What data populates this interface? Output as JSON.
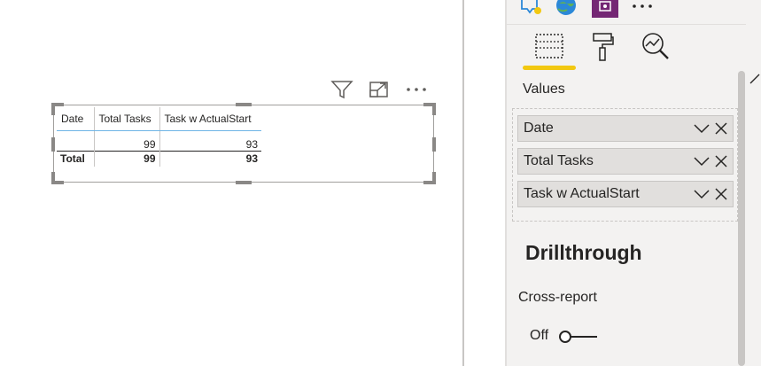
{
  "visual_header": {
    "filter_icon": "filter-icon",
    "focus_icon": "focus-mode-icon",
    "more_icon": "more-options-icon"
  },
  "table": {
    "columns": [
      "Date",
      "Total Tasks",
      "Task w ActualStart"
    ],
    "row": {
      "date": "",
      "total_tasks": "99",
      "task_w_actualstart": "93"
    },
    "total": {
      "label": "Total",
      "total_tasks": "99",
      "task_w_actualstart": "93"
    }
  },
  "pane": {
    "viz_icons": [
      "map-pin-icon",
      "globe-icon",
      "custom-visual-icon",
      "more-visuals-icon"
    ],
    "tabs": [
      {
        "name": "fields-tab",
        "icon": "fields-icon"
      },
      {
        "name": "format-tab",
        "icon": "paint-roller-icon"
      },
      {
        "name": "analytics-tab",
        "icon": "analytics-icon"
      }
    ],
    "values_label": "Values",
    "fields": [
      "Date",
      "Total Tasks",
      "Task w ActualStart"
    ],
    "drillthrough_title": "Drillthrough",
    "cross_report_label": "Cross-report",
    "toggle_state": "Off"
  },
  "colors": {
    "accent": "#f2c811",
    "pane_bg": "#f3f2f1",
    "pill_bg": "#e1dfdd",
    "header_underline": "#6fb5e6"
  }
}
